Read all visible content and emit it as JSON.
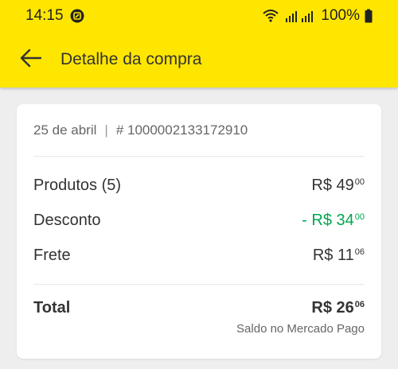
{
  "status_bar": {
    "time": "14:15",
    "battery_text": "100%"
  },
  "app_bar": {
    "title": "Detalhe da compra"
  },
  "purchase": {
    "date": "25 de abril",
    "separator": "|",
    "order_number": "# 1000002133172910"
  },
  "summary": {
    "products": {
      "label": "Produtos (5)",
      "amount_main": "R$ 49",
      "amount_cents": "00"
    },
    "discount": {
      "label": "Desconto",
      "amount_main": "- R$ 34",
      "amount_cents": "00",
      "color": "#00a650"
    },
    "shipping": {
      "label": "Frete",
      "amount_main": "R$ 11",
      "amount_cents": "06"
    }
  },
  "total": {
    "label": "Total",
    "amount_main": "R$ 26",
    "amount_cents": "06",
    "payment_method": "Saldo no Mercado Pago"
  },
  "colors": {
    "brand_yellow": "#ffe600",
    "discount_green": "#00a650"
  },
  "icons": [
    "status-app-icon",
    "wifi-icon",
    "signal-icon",
    "battery-icon",
    "back-arrow-icon"
  ]
}
